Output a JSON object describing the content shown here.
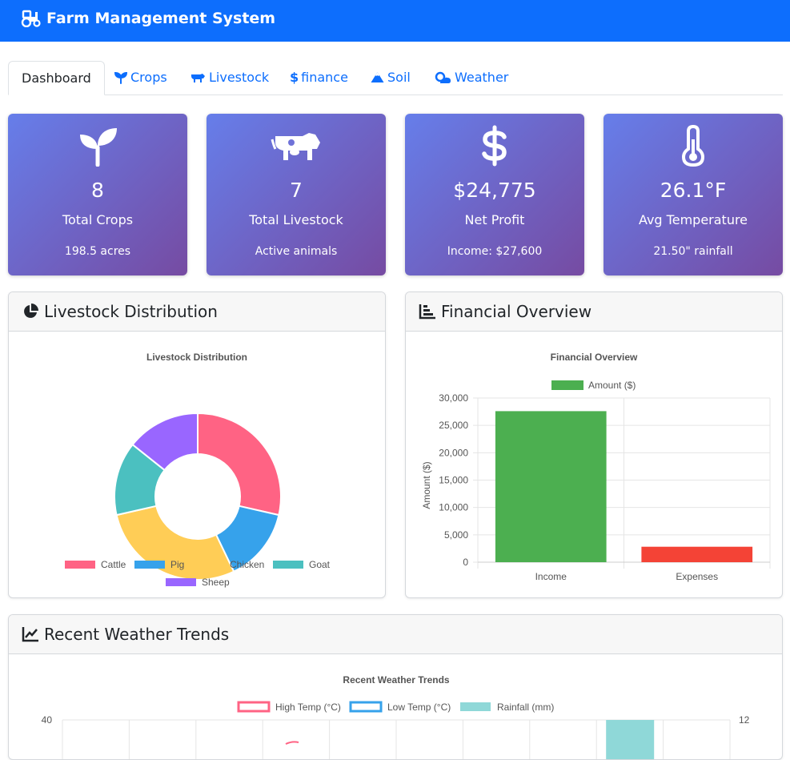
{
  "app": {
    "title": "Farm Management System",
    "brand_icon": "tractor-icon"
  },
  "tabs": [
    {
      "label": "Dashboard",
      "active": true
    },
    {
      "label": "Crops",
      "icon": "seedling-icon"
    },
    {
      "label": "Livestock",
      "icon": "cow-icon"
    },
    {
      "label": "finance",
      "icon": "dollar-icon"
    },
    {
      "label": "Soil",
      "icon": "mountain-icon"
    },
    {
      "label": "Weather",
      "icon": "cloud-sun-icon"
    }
  ],
  "stats": [
    {
      "value": "8",
      "label": "Total Crops",
      "sub": "198.5 acres",
      "icon": "seedling-icon"
    },
    {
      "value": "7",
      "label": "Total Livestock",
      "sub": "Active animals",
      "icon": "cow-icon"
    },
    {
      "value": "$24,775",
      "label": "Net Profit",
      "sub": "Income: $27,600",
      "icon": "dollar-icon"
    },
    {
      "value": "26.1°F",
      "label": "Avg Temperature",
      "sub": "21.50\" rainfall",
      "icon": "thermometer-icon"
    }
  ],
  "panels": {
    "livestock": {
      "title": "Livestock Distribution"
    },
    "finance": {
      "title": "Financial Overview"
    },
    "weather": {
      "title": "Recent Weather Trends"
    }
  },
  "chart_data": [
    {
      "type": "pie",
      "title": "Livestock Distribution",
      "categories": [
        "Cattle",
        "Pig",
        "Chicken",
        "Goat",
        "Sheep"
      ],
      "values": [
        2,
        1,
        2,
        1,
        1
      ],
      "colors": [
        "#ff6384",
        "#36a2eb",
        "#ffcd56",
        "#4bc0c0",
        "#9966ff"
      ],
      "legend_position": "bottom"
    },
    {
      "type": "bar",
      "title": "Financial Overview",
      "categories": [
        "Income",
        "Expenses"
      ],
      "series": [
        {
          "name": "Amount ($)",
          "values": [
            27600,
            2825
          ]
        }
      ],
      "colors": [
        "#4caf50",
        "#f44336"
      ],
      "ylabel": "Amount ($)",
      "ylim": [
        0,
        30000
      ],
      "yticks": [
        "30,000",
        "25,000",
        "20,000",
        "15,000",
        "10,000",
        "5,000",
        "0"
      ],
      "legend_position": "top"
    },
    {
      "type": "line",
      "title": "Recent Weather Trends",
      "series": [
        {
          "name": "High Temp (°C)",
          "color": "#ff6384"
        },
        {
          "name": "Low Temp (°C)",
          "color": "#36a2eb"
        },
        {
          "name": "Rainfall (mm)",
          "color": "#8fd8d8"
        }
      ],
      "y_left_top_tick": "40",
      "y_right_top_tick": "12"
    }
  ]
}
